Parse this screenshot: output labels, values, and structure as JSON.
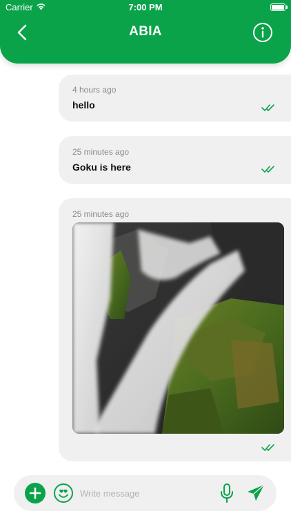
{
  "status_bar": {
    "carrier": "Carrier",
    "time": "7:00 PM"
  },
  "header": {
    "title": "ABIA"
  },
  "messages": [
    {
      "time": "4 hours ago",
      "text": "hello",
      "status": "read"
    },
    {
      "time": "25 minutes ago",
      "text": "Goku is here",
      "status": "read"
    },
    {
      "time": "25 minutes ago",
      "type": "image",
      "status": "read"
    }
  ],
  "composer": {
    "placeholder": "Write message"
  },
  "colors": {
    "accent": "#0aa34a",
    "bubble": "#f0f0f0",
    "meta_text": "#8a8a8a"
  }
}
